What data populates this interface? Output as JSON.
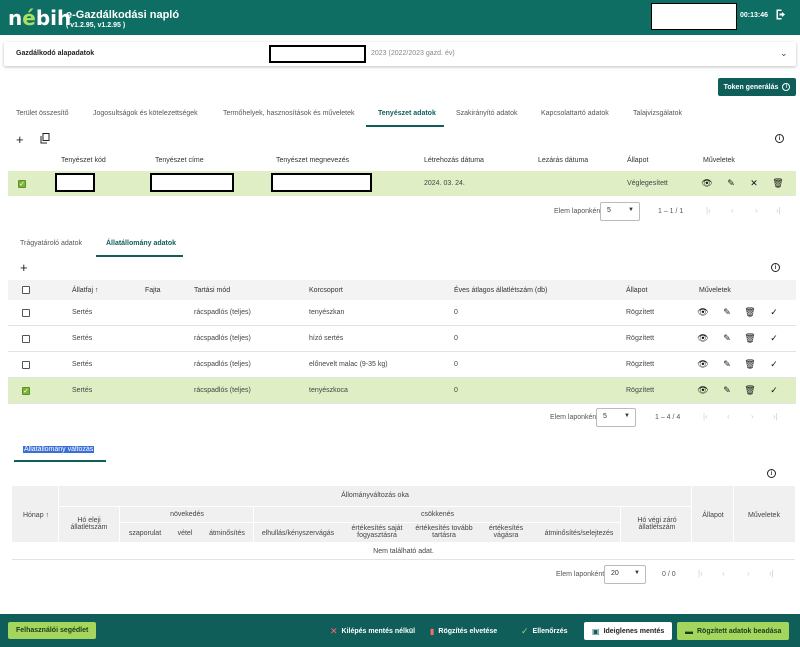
{
  "header": {
    "logo_prefix": "n",
    "logo_accent": "é",
    "logo_suffix": "bih",
    "title": "e-Gazdálkodási napló",
    "version": "( v1.2.95, v1.2.95 )",
    "time": "00:13:46"
  },
  "base_panel": {
    "label": "Gazdálkodó alapadatok",
    "year": "2023 (2022/2023 gazd. év)"
  },
  "token_button": "Token generálás",
  "tabs": [
    "Terület összesítő",
    "Jogosultságok és kötelezettségek",
    "Termőhelyek, hasznosítások és műveletek",
    "Tenyészet adatok",
    "Szakirányító adatok",
    "Kapcsolattartó adatok",
    "Talajvizsgálatok"
  ],
  "farm_table": {
    "headers": [
      "Tenyészet kód",
      "Tenyészet címe",
      "Tenyészet megnevezés",
      "Létrehozás dátuma",
      "Lezárás dátuma",
      "Állapot",
      "Műveletek"
    ],
    "row": {
      "created": "2024. 03. 24.",
      "closed": "",
      "status": "Véglegesített"
    },
    "pager": {
      "label": "Elem laponként:",
      "size": "5",
      "range": "1 – 1 / 1"
    }
  },
  "subtabs": [
    "Trágyatároló adatok",
    "Állatállomány adatok"
  ],
  "stock_table": {
    "headers": [
      "Állatfaj ↑",
      "Fajta",
      "Tartási mód",
      "Korcsoport",
      "Éves átlagos állatlétszám (db)",
      "Állapot",
      "Műveletek"
    ],
    "rows": [
      {
        "species": "Sertés",
        "breed": "",
        "mode": "rácspadlós (teljes)",
        "group": "tenyészkan",
        "avg": "0",
        "status": "Rögzített",
        "checked": false
      },
      {
        "species": "Sertés",
        "breed": "",
        "mode": "rácspadlós (teljes)",
        "group": "hízó sertés",
        "avg": "0",
        "status": "Rögzített",
        "checked": false
      },
      {
        "species": "Sertés",
        "breed": "",
        "mode": "rácspadlós (teljes)",
        "group": "előnevelt malac (9-35 kg)",
        "avg": "0",
        "status": "Rögzített",
        "checked": false
      },
      {
        "species": "Sertés",
        "breed": "",
        "mode": "rácspadlós (teljes)",
        "group": "tenyészkoca",
        "avg": "0",
        "status": "Rögzített",
        "checked": true
      }
    ],
    "pager": {
      "label": "Elem laponként:",
      "size": "5",
      "range": "1 – 4 / 4"
    }
  },
  "change_section": {
    "title": "Állatállomány változás",
    "headers": {
      "month": "Hónap ↑",
      "group_title": "Állományváltozás oka",
      "start": "Hó eleji állatlétszám",
      "increase": "növekedés",
      "decrease": "csökkenés",
      "inc_cols": [
        "szaporulat",
        "vétel",
        "átminősítés"
      ],
      "dec_cols": [
        "elhullás/kényszervágás",
        "értékesítés saját fogyasztásra",
        "értékesítés tovább tartásra",
        "értékesítés vágásra",
        "átminősítés/selejtezés"
      ],
      "end": "Hó végi záró állatlétszám",
      "status": "Állapot",
      "actions": "Műveletek"
    },
    "empty": "Nem található adat.",
    "pager": {
      "label": "Elem laponként:",
      "size": "20",
      "range": "0 / 0"
    }
  },
  "footer": {
    "help": "Felhasználói segédlet",
    "exit": "Kilépés mentés nélkül",
    "discard": "Rögzítés elvetése",
    "check": "Ellenőrzés",
    "temp_save": "Ideiglenes mentés",
    "submit": "Rögzített adatok beadása"
  }
}
